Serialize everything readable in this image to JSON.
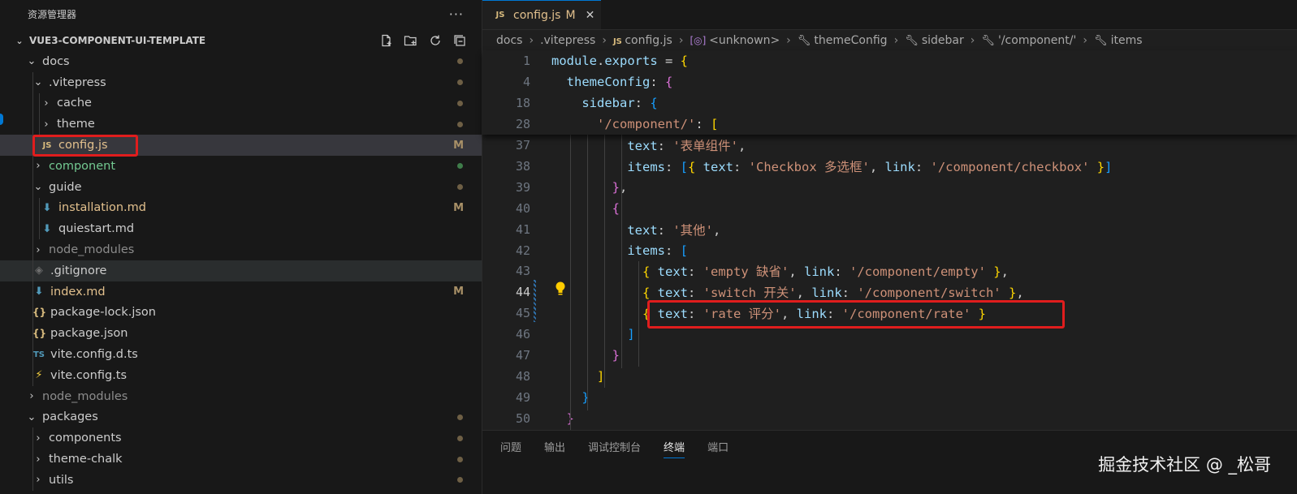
{
  "explorer": {
    "title": "资源管理器",
    "more_label": "···",
    "project": "VUE3-COMPONENT-UI-TEMPLATE",
    "tree": [
      {
        "label": "docs",
        "depth": 1,
        "kind": "folder",
        "open": true,
        "badge": "dot",
        "color": "#cccccc"
      },
      {
        "label": ".vitepress",
        "depth": 2,
        "kind": "folder",
        "open": true,
        "badge": "dot",
        "color": "#cccccc"
      },
      {
        "label": "cache",
        "depth": 3,
        "kind": "folder",
        "open": false,
        "badge": "dot",
        "color": "#cccccc"
      },
      {
        "label": "theme",
        "depth": 3,
        "kind": "folder",
        "open": false,
        "badge": "dot",
        "color": "#cccccc"
      },
      {
        "label": "config.js",
        "depth": 3,
        "kind": "js",
        "badge": "M",
        "color": "#e2c08d",
        "selected": true
      },
      {
        "label": "component",
        "depth": 2,
        "kind": "folder",
        "open": false,
        "badge": "dot-green",
        "color": "#73c991"
      },
      {
        "label": "guide",
        "depth": 2,
        "kind": "folder",
        "open": true,
        "badge": "dot",
        "color": "#cccccc"
      },
      {
        "label": "installation.md",
        "depth": 3,
        "kind": "md",
        "badge": "M",
        "color": "#e2c08d"
      },
      {
        "label": "quiestart.md",
        "depth": 3,
        "kind": "md",
        "badge": "",
        "color": "#cccccc"
      },
      {
        "label": "node_modules",
        "depth": 2,
        "kind": "folder",
        "open": false,
        "badge": "",
        "color": "#8c8c8c"
      },
      {
        "label": ".gitignore",
        "depth": 2,
        "kind": "git",
        "badge": "",
        "color": "#cccccc",
        "hover": true
      },
      {
        "label": "index.md",
        "depth": 2,
        "kind": "md",
        "badge": "M",
        "color": "#e2c08d"
      },
      {
        "label": "package-lock.json",
        "depth": 2,
        "kind": "json",
        "badge": "",
        "color": "#cccccc"
      },
      {
        "label": "package.json",
        "depth": 2,
        "kind": "json",
        "badge": "",
        "color": "#cccccc"
      },
      {
        "label": "vite.config.d.ts",
        "depth": 2,
        "kind": "ts",
        "badge": "",
        "color": "#cccccc"
      },
      {
        "label": "vite.config.ts",
        "depth": 2,
        "kind": "vite",
        "badge": "",
        "color": "#cccccc"
      },
      {
        "label": "node_modules",
        "depth": 1,
        "kind": "folder",
        "open": false,
        "badge": "",
        "color": "#8c8c8c"
      },
      {
        "label": "packages",
        "depth": 1,
        "kind": "folder",
        "open": true,
        "badge": "dot",
        "color": "#cccccc"
      },
      {
        "label": "components",
        "depth": 2,
        "kind": "folder",
        "open": false,
        "badge": "dot",
        "color": "#cccccc"
      },
      {
        "label": "theme-chalk",
        "depth": 2,
        "kind": "folder",
        "open": false,
        "badge": "dot",
        "color": "#cccccc"
      },
      {
        "label": "utils",
        "depth": 2,
        "kind": "folder",
        "open": false,
        "badge": "dot",
        "color": "#cccccc"
      }
    ]
  },
  "tab": {
    "icon": "JS",
    "label": "config.js",
    "status": "M",
    "close": "✕"
  },
  "breadcrumb": [
    {
      "label": "docs",
      "icon": ""
    },
    {
      "label": ".vitepress",
      "icon": ""
    },
    {
      "label": "config.js",
      "icon": "JS"
    },
    {
      "label": "<unknown>",
      "icon": "symbol"
    },
    {
      "label": "themeConfig",
      "icon": "wrench"
    },
    {
      "label": "sidebar",
      "icon": "wrench"
    },
    {
      "label": "'/component/'",
      "icon": "wrench"
    },
    {
      "label": "items",
      "icon": "wrench"
    }
  ],
  "editor": {
    "active_line": "44",
    "sticky_lines": [
      {
        "num": "1",
        "tokens": [
          [
            "module",
            "k"
          ],
          [
            ".",
            "p"
          ],
          [
            "exports",
            "k"
          ],
          [
            " = ",
            "p"
          ],
          [
            "{",
            "b1"
          ]
        ]
      },
      {
        "num": "4",
        "tokens": [
          [
            "  themeConfig",
            "k"
          ],
          [
            ": ",
            "p"
          ],
          [
            "{",
            "b2"
          ]
        ]
      },
      {
        "num": "18",
        "tokens": [
          [
            "    sidebar",
            "k"
          ],
          [
            ": ",
            "p"
          ],
          [
            "{",
            "b3"
          ]
        ]
      },
      {
        "num": "28",
        "tokens": [
          [
            "      ",
            "p"
          ],
          [
            "'/component/'",
            "s"
          ],
          [
            ": ",
            "p"
          ],
          [
            "[",
            "b1"
          ]
        ]
      }
    ],
    "lines": [
      {
        "num": "37",
        "tokens": [
          [
            "          text",
            "k"
          ],
          [
            ": ",
            "p"
          ],
          [
            "'表单组件'",
            "s"
          ],
          [
            ",",
            "p"
          ]
        ]
      },
      {
        "num": "38",
        "tokens": [
          [
            "          items",
            "k"
          ],
          [
            ": ",
            "p"
          ],
          [
            "[",
            "b3"
          ],
          [
            "{ ",
            "b1"
          ],
          [
            "text",
            "k"
          ],
          [
            ": ",
            "p"
          ],
          [
            "'Checkbox 多选框'",
            "s"
          ],
          [
            ", ",
            "p"
          ],
          [
            "link",
            "k"
          ],
          [
            ": ",
            "p"
          ],
          [
            "'/component/checkbox'",
            "s"
          ],
          [
            " }",
            "b1"
          ],
          [
            "]",
            "b3"
          ]
        ]
      },
      {
        "num": "39",
        "tokens": [
          [
            "        }",
            "b2"
          ],
          [
            ",",
            "p"
          ]
        ]
      },
      {
        "num": "40",
        "tokens": [
          [
            "        {",
            "b2"
          ]
        ]
      },
      {
        "num": "41",
        "tokens": [
          [
            "          text",
            "k"
          ],
          [
            ": ",
            "p"
          ],
          [
            "'其他'",
            "s"
          ],
          [
            ",",
            "p"
          ]
        ]
      },
      {
        "num": "42",
        "tokens": [
          [
            "          items",
            "k"
          ],
          [
            ": ",
            "p"
          ],
          [
            "[",
            "b3"
          ]
        ]
      },
      {
        "num": "43",
        "tokens": [
          [
            "            { ",
            "b1"
          ],
          [
            "text",
            "k"
          ],
          [
            ": ",
            "p"
          ],
          [
            "'empty 缺省'",
            "s"
          ],
          [
            ", ",
            "p"
          ],
          [
            "link",
            "k"
          ],
          [
            ": ",
            "p"
          ],
          [
            "'/component/empty'",
            "s"
          ],
          [
            " }",
            "b1"
          ],
          [
            ",",
            "p"
          ]
        ]
      },
      {
        "num": "44",
        "tokens": [
          [
            "            { ",
            "b1"
          ],
          [
            "text",
            "k"
          ],
          [
            ": ",
            "p"
          ],
          [
            "'switch 开关'",
            "s"
          ],
          [
            ", ",
            "p"
          ],
          [
            "link",
            "k"
          ],
          [
            ": ",
            "p"
          ],
          [
            "'/component/switch'",
            "s"
          ],
          [
            " }",
            "b1"
          ],
          [
            ",",
            "p"
          ]
        ]
      },
      {
        "num": "45",
        "tokens": [
          [
            "            { ",
            "b1"
          ],
          [
            "text",
            "k"
          ],
          [
            ": ",
            "p"
          ],
          [
            "'rate 评分'",
            "s"
          ],
          [
            ", ",
            "p"
          ],
          [
            "link",
            "k"
          ],
          [
            ": ",
            "p"
          ],
          [
            "'/component/rate'",
            "s"
          ],
          [
            " }",
            "b1"
          ]
        ]
      },
      {
        "num": "46",
        "tokens": [
          [
            "          ]",
            "b3"
          ]
        ]
      },
      {
        "num": "47",
        "tokens": [
          [
            "        }",
            "b2"
          ]
        ]
      },
      {
        "num": "48",
        "tokens": [
          [
            "      ]",
            "b1"
          ]
        ]
      },
      {
        "num": "49",
        "tokens": [
          [
            "    }",
            "b3"
          ]
        ]
      },
      {
        "num": "50",
        "tokens": [
          [
            "  }",
            "b2"
          ]
        ]
      }
    ]
  },
  "panel": {
    "tabs": [
      {
        "label": "问题",
        "active": false
      },
      {
        "label": "输出",
        "active": false
      },
      {
        "label": "调试控制台",
        "active": false
      },
      {
        "label": "终端",
        "active": true
      },
      {
        "label": "端口",
        "active": false
      }
    ]
  },
  "watermark": "掘金技术社区 @ _松哥"
}
